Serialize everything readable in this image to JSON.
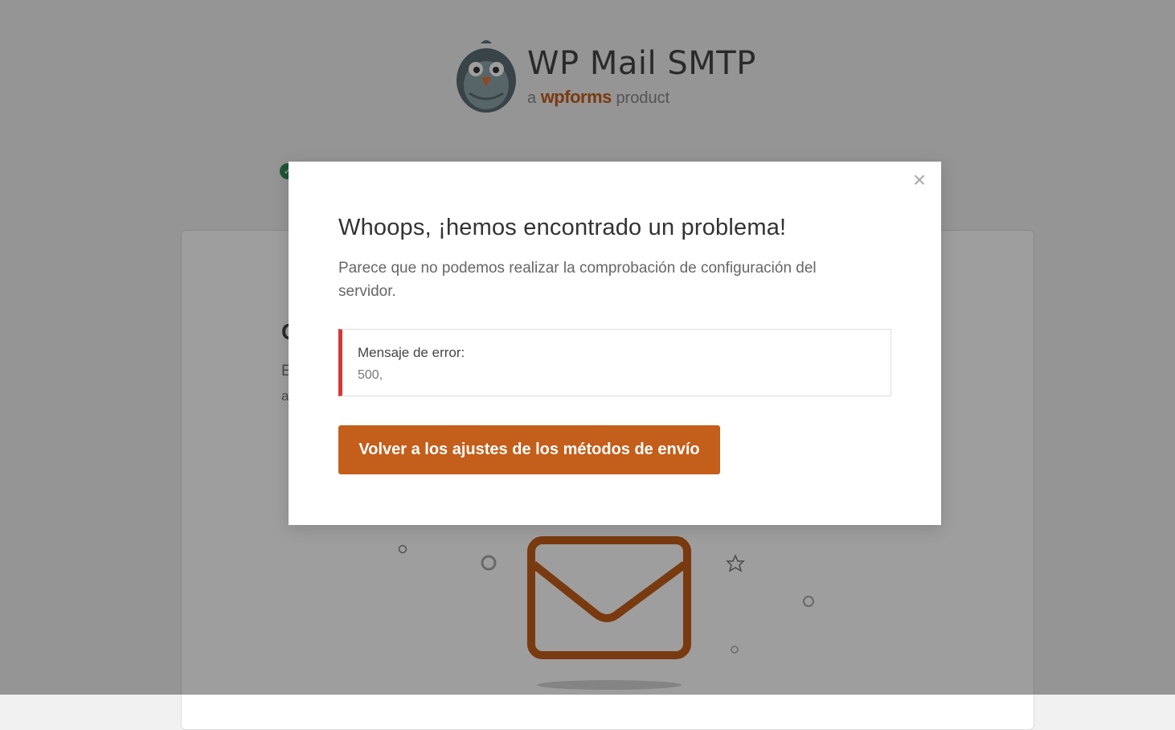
{
  "brand": {
    "name": "WP Mail SMTP",
    "sub_a": "a",
    "sub_wpforms": "wpforms",
    "sub_product": "product"
  },
  "background_card": {
    "heading_peek": "C",
    "line1_peek": "E",
    "line2_peek": "a"
  },
  "colors": {
    "accent": "#c45e1b",
    "error": "#d63638",
    "success": "#2f8b58"
  },
  "modal": {
    "close_icon": "×",
    "title": "Whoops, ¡hemos encontrado un problema!",
    "description": "Parece que no podemos realizar la comprobación de configuración del servidor.",
    "error_label": "Mensaje de error:",
    "error_value": "500,",
    "button_label": "Volver a los ajustes de los métodos de envío"
  }
}
